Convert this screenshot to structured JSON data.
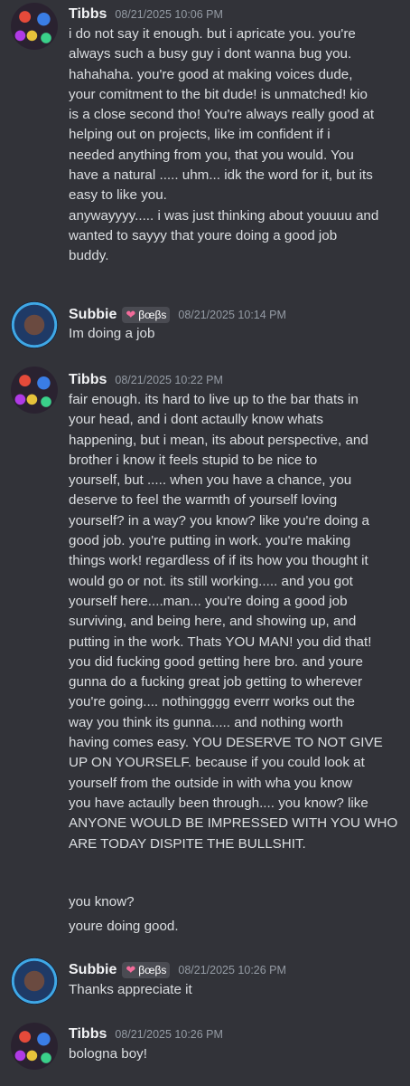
{
  "messages": [
    {
      "author": "Tibbs",
      "timestamp": "08/21/2025 10:06 PM",
      "lines": [
        "i do not say it enough. but i apricate you.  you're",
        "always such a busy guy i dont wanna bug you.",
        "hahahaha.  you're good at making voices dude,",
        "your comitment to the bit dude! is unmatched! kio",
        "is a close second tho!  You're always really good at",
        "helping out on projects, like im confident if i",
        "needed anything from you, that you would. You",
        "have a natural ..... uhm... idk the word for it, but its",
        "easy to like you.",
        "anywayyyy..... i was just thinking about youuuu and",
        "wanted to sayyy that youre doing a good job",
        "buddy."
      ]
    },
    {
      "author": "Subbie",
      "tag": "βœβs",
      "tag_icon": "heart-icon",
      "timestamp": "08/21/2025 10:14 PM",
      "lines": [
        "Im doing a job"
      ]
    },
    {
      "author": "Tibbs",
      "timestamp": "08/21/2025 10:22 PM",
      "lines": [
        "fair enough. its hard to live up to the bar thats in",
        "your head, and i dont actaully know whats",
        "happening, but i mean, its about perspective, and",
        "brother i know it feels stupid to be nice to",
        "yourself, but ..... when you have a chance, you",
        "deserve to feel the warmth of yourself loving",
        "yourself? in a way? you know? like you're doing a",
        "good job.  you're putting in work. you're making",
        "things work! regardless of if its how you thought it",
        "would go or not. its still working..... and you got",
        "yourself here....man... you're doing a good job",
        "surviving, and being here, and showing up, and",
        "putting in the work.  Thats YOU MAN! you did that!",
        "you did fucking good getting here bro. and youre",
        "gunna do a fucking great job getting to wherever",
        "you're going.... nothingggg everrr works out the",
        "way you think its gunna..... and nothing worth",
        "having comes easy.  YOU DESERVE TO NOT GIVE",
        "UP ON YOURSELF. because if you could look at",
        "yourself from the outside in with wha you know",
        "you have actaully been through.... you know? like",
        "ANYONE WOULD BE IMPRESSED WITH YOU WHO",
        "ARE TODAY DISPITE THE BULLSHIT."
      ],
      "extra": [
        "you know?",
        "youre doing good."
      ]
    },
    {
      "author": "Subbie",
      "tag": "βœβs",
      "tag_icon": "heart-icon",
      "timestamp": "08/21/2025 10:26 PM",
      "lines": [
        "Thanks appreciate it"
      ]
    },
    {
      "author": "Tibbs",
      "timestamp": "08/21/2025 10:26 PM",
      "lines": [
        "bologna boy!"
      ]
    }
  ]
}
